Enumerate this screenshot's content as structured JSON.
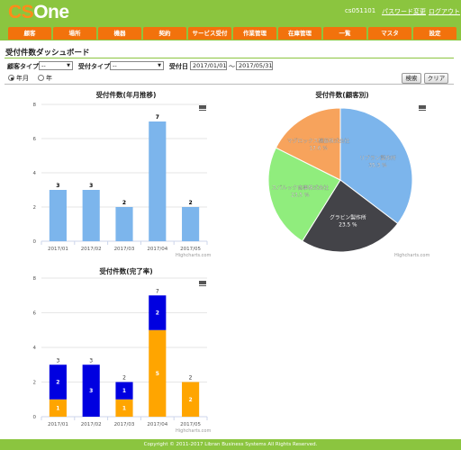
{
  "header": {
    "logo_cs": "CS",
    "logo_one": "One",
    "user": "cs051101",
    "password_link": "パスワード変更",
    "logout_link": "ログアウト"
  },
  "nav": {
    "tabs": [
      "顧客",
      "場所",
      "機器",
      "契約",
      "サービス受付",
      "作業管理",
      "在庫管理",
      "一覧",
      "マスタ",
      "設定"
    ]
  },
  "page": {
    "title": "受付件数ダッシュボード"
  },
  "filters": {
    "customer_type_label": "顧客タイプ",
    "customer_type_value": "--",
    "reception_type_label": "受付タイプ",
    "reception_type_value": "--",
    "date_label": "受付日",
    "date_from": "2017/01/01",
    "date_sep": "～",
    "date_to": "2017/05/31",
    "period_month": "年月",
    "period_year": "年",
    "search_button": "検索",
    "clear_button": "クリア"
  },
  "charts": {
    "credit": "Highcharts.com"
  },
  "chart_data": [
    {
      "type": "bar",
      "title": "受付件数(年月推移)",
      "categories": [
        "2017/01",
        "2017/02",
        "2017/03",
        "2017/04",
        "2017/05"
      ],
      "values": [
        3,
        3,
        2,
        7,
        2
      ],
      "ylim": [
        0,
        8
      ],
      "yticks": [
        0,
        2,
        4,
        6,
        8
      ],
      "grid": true,
      "color": "#7cb5ec"
    },
    {
      "type": "pie",
      "title": "受付件数(顧客別)",
      "labels": [
        "リブラン製作所",
        "グラビン製作所",
        "スバルック商事株式会社",
        "マグロックス機器株式会社"
      ],
      "values": [
        35.3,
        23.5,
        23.5,
        17.6
      ],
      "display": [
        "35.3 %",
        "23.5 %",
        "23.5 %",
        "17.6 %"
      ],
      "colors": [
        "#7cb5ec",
        "#434348",
        "#90ed7d",
        "#f7a35c"
      ]
    },
    {
      "type": "bar",
      "stacked": true,
      "title": "受付件数(完了率)",
      "categories": [
        "2017/01",
        "2017/02",
        "2017/03",
        "2017/04",
        "2017/05"
      ],
      "series": [
        {
          "values": [
            2,
            3,
            1,
            2,
            0
          ],
          "color": "#0000e0"
        },
        {
          "values": [
            1,
            0,
            1,
            5,
            2
          ],
          "color": "#ffa500"
        }
      ],
      "totals": [
        3,
        3,
        2,
        7,
        2
      ],
      "ylim": [
        0,
        8
      ],
      "yticks": [
        0,
        2,
        4,
        6,
        8
      ],
      "grid": true
    }
  ],
  "footer": {
    "copyright": "Copyright © 2011-2017 Libran Business Systems All Rights Reserved."
  }
}
